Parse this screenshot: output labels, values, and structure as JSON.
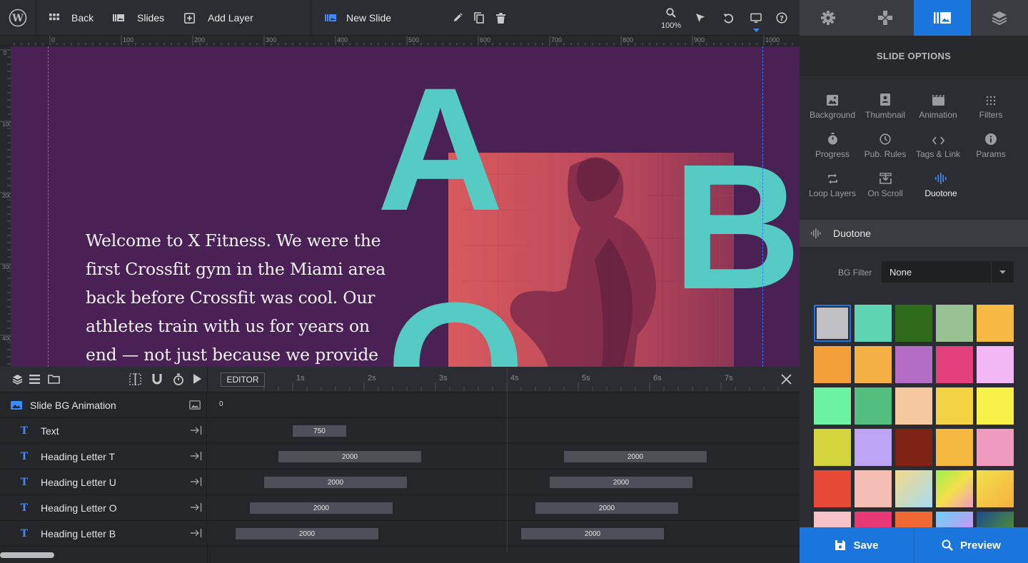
{
  "toolbar": {
    "back_label": "Back",
    "slides_label": "Slides",
    "add_layer_label": "Add Layer",
    "slide_name": "New Slide",
    "zoom": "100%"
  },
  "ruler": {
    "top_ticks": [
      "0",
      "100",
      "200",
      "300",
      "400",
      "500",
      "600",
      "700",
      "800",
      "900",
      "1000"
    ],
    "left_ticks": [
      "0",
      "100",
      "200",
      "300",
      "400"
    ]
  },
  "canvas": {
    "bg_color": "#4a2155",
    "accent_color": "#55cbc4",
    "letters": {
      "a": "A",
      "b": "B",
      "o": "O"
    },
    "body_text": "Welcome to X Fitness. We were the first Crossfit gym in the Miami area back before Crossfit was cool. Our athletes train with us for years on end — not just because we provide the"
  },
  "timeline": {
    "editor_label": "EDITOR",
    "time_ticks": [
      "1s",
      "2s",
      "3s",
      "4s",
      "5s",
      "6s",
      "7s"
    ],
    "bg_row": {
      "label": "Slide BG Animation",
      "start": "0"
    },
    "layers": [
      {
        "label": "Text",
        "bars": [
          "750"
        ]
      },
      {
        "label": "Heading Letter T",
        "bars": [
          "2000",
          "2000"
        ]
      },
      {
        "label": "Heading Letter U",
        "bars": [
          "2000",
          "2000"
        ]
      },
      {
        "label": "Heading Letter O",
        "bars": [
          "2000",
          "2000"
        ]
      },
      {
        "label": "Heading Letter B",
        "bars": [
          "2000",
          "2000"
        ]
      }
    ]
  },
  "panel": {
    "title": "SLIDE OPTIONS",
    "options": [
      {
        "label": "Background",
        "icon": "image-icon"
      },
      {
        "label": "Thumbnail",
        "icon": "thumbnail-icon"
      },
      {
        "label": "Animation",
        "icon": "film-icon"
      },
      {
        "label": "Filters",
        "icon": "grid-dots-icon"
      },
      {
        "label": "Progress",
        "icon": "stopwatch-icon"
      },
      {
        "label": "Pub. Rules",
        "icon": "clock-icon"
      },
      {
        "label": "Tags & Link",
        "icon": "code-icon"
      },
      {
        "label": "Params",
        "icon": "info-icon"
      },
      {
        "label": "Loop Layers",
        "icon": "loop-icon"
      },
      {
        "label": "On Scroll",
        "icon": "download-icon"
      },
      {
        "label": "Duotone",
        "icon": "waveform-icon"
      }
    ],
    "section_title": "Duotone",
    "bg_filter_label": "BG Filter",
    "bg_filter_value": "None",
    "swatches": [
      "#c0c0c4",
      "#5fd4b2",
      "#2e6b1a",
      "#9ac192",
      "#f5b944",
      "#f4a03a",
      "#f4b246",
      "#b46ec4",
      "#e2417d",
      "#f1b8f4",
      "#6cf2a0",
      "#55bf7f",
      "#f6c8a0",
      "#f3d243",
      "#f6f24a",
      "#d4d43c",
      "#bea4f4",
      "#7f2317",
      "#f4b740",
      "#f09cc0",
      "#e64a36",
      "#f4beb4",
      "#e8e29a",
      "#c6ee50",
      "#f4e04a",
      "#f6c2c8",
      "#e83878",
      "#ee6a32",
      "#7ac6f4",
      "#2c6a7c"
    ],
    "save_label": "Save",
    "preview_label": "Preview"
  }
}
